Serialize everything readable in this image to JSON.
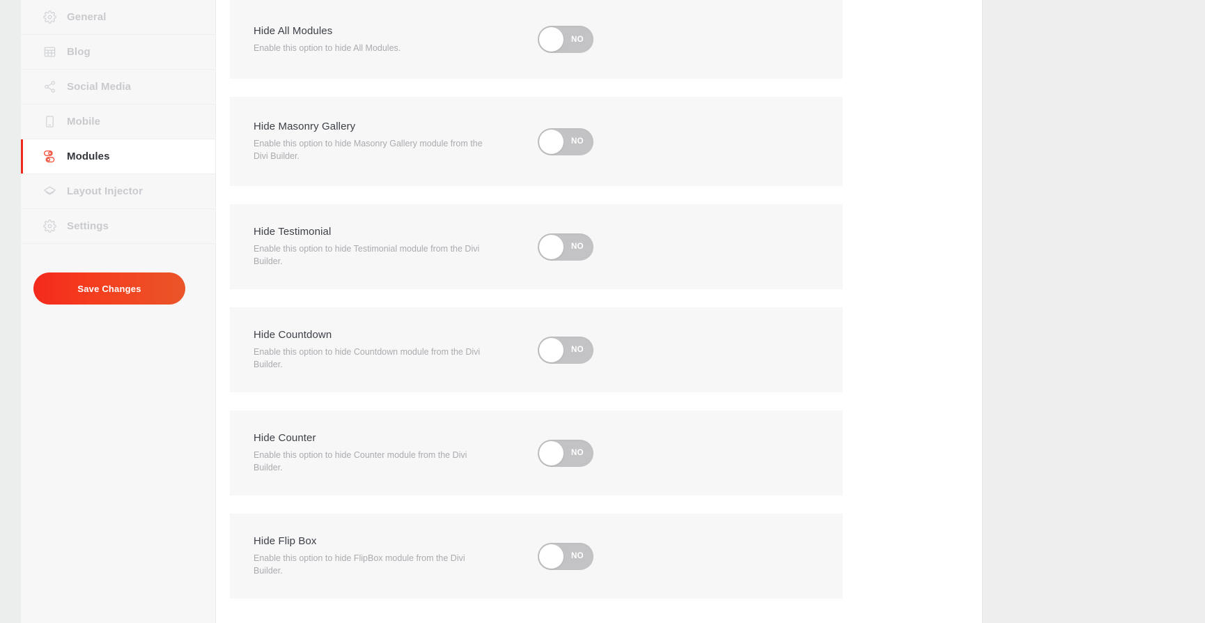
{
  "sidebar": {
    "items": [
      {
        "label": "General",
        "icon": "gear-icon",
        "active": false
      },
      {
        "label": "Blog",
        "icon": "grid-table-icon",
        "active": false
      },
      {
        "label": "Social Media",
        "icon": "share-nodes-icon",
        "active": false
      },
      {
        "label": "Mobile",
        "icon": "mobile-icon",
        "active": false
      },
      {
        "label": "Modules",
        "icon": "modules-icon",
        "active": true
      },
      {
        "label": "Layout Injector",
        "icon": "layers-icon",
        "active": false
      },
      {
        "label": "Settings",
        "icon": "gear-icon",
        "active": false
      }
    ],
    "save_label": "Save Changes"
  },
  "options": [
    {
      "title": "Hide All Modules",
      "description": "Enable this option to hide All Modules.",
      "toggle_value": "NO"
    },
    {
      "title": "Hide Masonry Gallery",
      "description": "Enable this option to hide Masonry Gallery module from the Divi Builder.",
      "toggle_value": "NO"
    },
    {
      "title": "Hide Testimonial",
      "description": "Enable this option to hide Testimonial module from the Divi Builder.",
      "toggle_value": "NO"
    },
    {
      "title": "Hide Countdown",
      "description": "Enable this option to hide Countdown module from the Divi Builder.",
      "toggle_value": "NO"
    },
    {
      "title": "Hide Counter",
      "description": "Enable this option to hide Counter module from the Divi Builder.",
      "toggle_value": "NO"
    },
    {
      "title": "Hide Flip Box",
      "description": "Enable this option to hide FlipBox module from the Divi Builder.",
      "toggle_value": "NO"
    }
  ],
  "colors": {
    "accent": "#ef2a1f",
    "accent_gradient_end": "#ea5528",
    "active_text": "#33363b",
    "muted_text": "#c9cacd",
    "card_bg": "#f7f7f8",
    "toggle_off": "#c3c3c5"
  }
}
